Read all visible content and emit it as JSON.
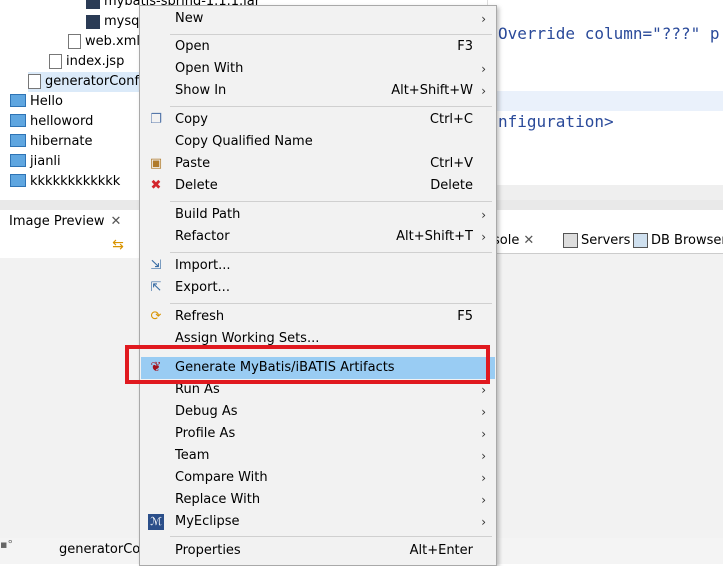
{
  "tree": {
    "items": [
      {
        "label": "mybatis-spring-1.1.1.jar",
        "icon": "jar-icon"
      },
      {
        "label": "mysql",
        "icon": "jar-icon"
      },
      {
        "label": "web.xml",
        "icon": "xml-file-icon"
      },
      {
        "label": "index.jsp",
        "icon": "jsp-file-icon"
      },
      {
        "label": "generatorConfig",
        "icon": "xml-file-icon"
      },
      {
        "label": "Hello",
        "icon": "folder-icon"
      },
      {
        "label": "helloword",
        "icon": "folder-icon"
      },
      {
        "label": "hibernate",
        "icon": "folder-icon"
      },
      {
        "label": "jianli",
        "icon": "folder-icon"
      },
      {
        "label": "kkkkkkkkkkkk",
        "icon": "folder-icon"
      }
    ]
  },
  "editor": {
    "line1": "Override column=\"???\" p",
    "line2": "nfiguration>"
  },
  "image_preview": {
    "tab_label": "Image Preview",
    "close_glyph": "✕"
  },
  "right_tabs": [
    {
      "label": "sole",
      "close": "✕"
    },
    {
      "label": "Servers"
    },
    {
      "label": "DB Browser"
    }
  ],
  "status": {
    "text": "generatorCon"
  },
  "menu": {
    "items": [
      {
        "label": "New",
        "accel": "",
        "submenu": true
      },
      {
        "label": "Open",
        "accel": "F3",
        "submenu": false
      },
      {
        "label": "Open With",
        "accel": "",
        "submenu": true
      },
      {
        "label": "Show In",
        "accel": "Alt+Shift+W",
        "submenu": true
      },
      {
        "label": "Copy",
        "accel": "Ctrl+C",
        "submenu": false,
        "icon": "copy-icon"
      },
      {
        "label": "Copy Qualified Name",
        "accel": "",
        "submenu": false
      },
      {
        "label": "Paste",
        "accel": "Ctrl+V",
        "submenu": false,
        "icon": "paste-icon"
      },
      {
        "label": "Delete",
        "accel": "Delete",
        "submenu": false,
        "icon": "delete-icon"
      },
      {
        "label": "Build Path",
        "accel": "",
        "submenu": true
      },
      {
        "label": "Refactor",
        "accel": "Alt+Shift+T",
        "submenu": true
      },
      {
        "label": "Import...",
        "accel": "",
        "submenu": false,
        "icon": "import-icon"
      },
      {
        "label": "Export...",
        "accel": "",
        "submenu": false,
        "icon": "export-icon"
      },
      {
        "label": "Refresh",
        "accel": "F5",
        "submenu": false,
        "icon": "refresh-icon"
      },
      {
        "label": "Assign Working Sets...",
        "accel": "",
        "submenu": false
      },
      {
        "label": "Generate MyBatis/iBATIS Artifacts",
        "accel": "",
        "submenu": false,
        "icon": "mybatis-bird-icon",
        "highlighted": true
      },
      {
        "label": "Run As",
        "accel": "",
        "submenu": true
      },
      {
        "label": "Debug As",
        "accel": "",
        "submenu": true
      },
      {
        "label": "Profile As",
        "accel": "",
        "submenu": true
      },
      {
        "label": "Team",
        "accel": "",
        "submenu": true
      },
      {
        "label": "Compare With",
        "accel": "",
        "submenu": true
      },
      {
        "label": "Replace With",
        "accel": "",
        "submenu": true
      },
      {
        "label": "MyEclipse",
        "accel": "",
        "submenu": true,
        "icon": "myeclipse-icon"
      },
      {
        "label": "Properties",
        "accel": "Alt+Enter",
        "submenu": false
      }
    ],
    "highlight_color": "#99ccf3",
    "annotation_color": "#e0191f"
  }
}
